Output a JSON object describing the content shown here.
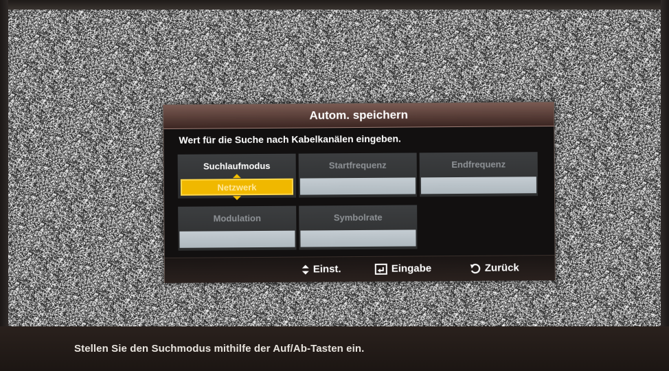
{
  "screen": {
    "hint": "Stellen Sie den Suchmodus mithilfe der Auf/Ab-Tasten ein."
  },
  "dialog": {
    "title": "Autom. speichern",
    "instruction": "Wert für die Suche nach Kabelkanälen eingeben.",
    "fields": [
      {
        "label": "Suchlaufmodus",
        "value": "Netzwerk",
        "active": true
      },
      {
        "label": "Startfrequenz",
        "value": "",
        "active": false
      },
      {
        "label": "Endfrequenz",
        "value": "",
        "active": false
      },
      {
        "label": "Modulation",
        "value": "",
        "active": false
      },
      {
        "label": "Symbolrate",
        "value": "",
        "active": false
      }
    ],
    "footer": {
      "adjust": {
        "icon": "up-down-arrows-icon",
        "label": "Einst."
      },
      "enter": {
        "icon": "enter-icon",
        "label": "Eingabe"
      },
      "back": {
        "icon": "return-icon",
        "label": "Zurück"
      }
    }
  },
  "colors": {
    "highlight": "#f0b800",
    "title_bar": "#5a3e38",
    "field_bg": "#35373a"
  }
}
